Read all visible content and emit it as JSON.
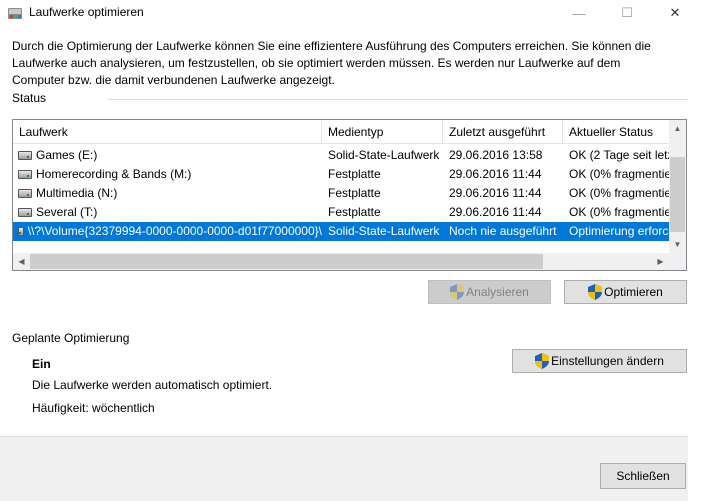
{
  "window": {
    "title": "Laufwerke optimieren",
    "controls": {
      "minimize": "—",
      "maximize": "☐",
      "close": "✕"
    }
  },
  "intro": {
    "text": "Durch die Optimierung der Laufwerke können Sie eine effizientere Ausführung des Computers erreichen. Sie können die Laufwerke auch analysieren, um festzustellen, ob sie optimiert werden müssen. Es werden nur Laufwerke auf dem Computer bzw. die damit verbundenen Laufwerke angezeigt."
  },
  "status": {
    "label": "Status",
    "columns": [
      "Laufwerk",
      "Medientyp",
      "Zuletzt ausgeführt",
      "Aktueller Status"
    ],
    "rows": [
      {
        "drive": "Games (E:)",
        "media": "Solid-State-Laufwerk",
        "last": "29.06.2016 13:58",
        "status": "OK (2 Tage seit letz",
        "selected": false
      },
      {
        "drive": "Homerecording & Bands (M:)",
        "media": "Festplatte",
        "last": "29.06.2016 11:44",
        "status": "OK (0% fragmentie",
        "selected": false
      },
      {
        "drive": "Multimedia (N:)",
        "media": "Festplatte",
        "last": "29.06.2016 11:44",
        "status": "OK (0% fragmentie",
        "selected": false
      },
      {
        "drive": "Several (T:)",
        "media": "Festplatte",
        "last": "29.06.2016 11:44",
        "status": "OK (0% fragmentie",
        "selected": false
      },
      {
        "drive": "\\\\?\\Volume{32379994-0000-0000-0000-d01f77000000}\\",
        "media": "Solid-State-Laufwerk",
        "last": "Noch nie ausgeführt",
        "status": "Optimierung erforc",
        "selected": true
      }
    ],
    "scroll_arrows": {
      "up": "▲",
      "down": "▼",
      "left": "◀",
      "right": "▶"
    }
  },
  "actions": {
    "analyze_label": "Analysieren",
    "optimize_label": "Optimieren"
  },
  "scheduled": {
    "label": "Geplante Optimierung",
    "state": "Ein",
    "description": "Die Laufwerke werden automatisch optimiert.",
    "frequency": "Häufigkeit: wöchentlich",
    "change_settings_label": "Einstellungen ändern"
  },
  "footer": {
    "close_label": "Schließen"
  },
  "colors": {
    "selection": "#0078d7",
    "shield_blue": "#1f5fbf",
    "shield_yellow": "#f2c200"
  }
}
